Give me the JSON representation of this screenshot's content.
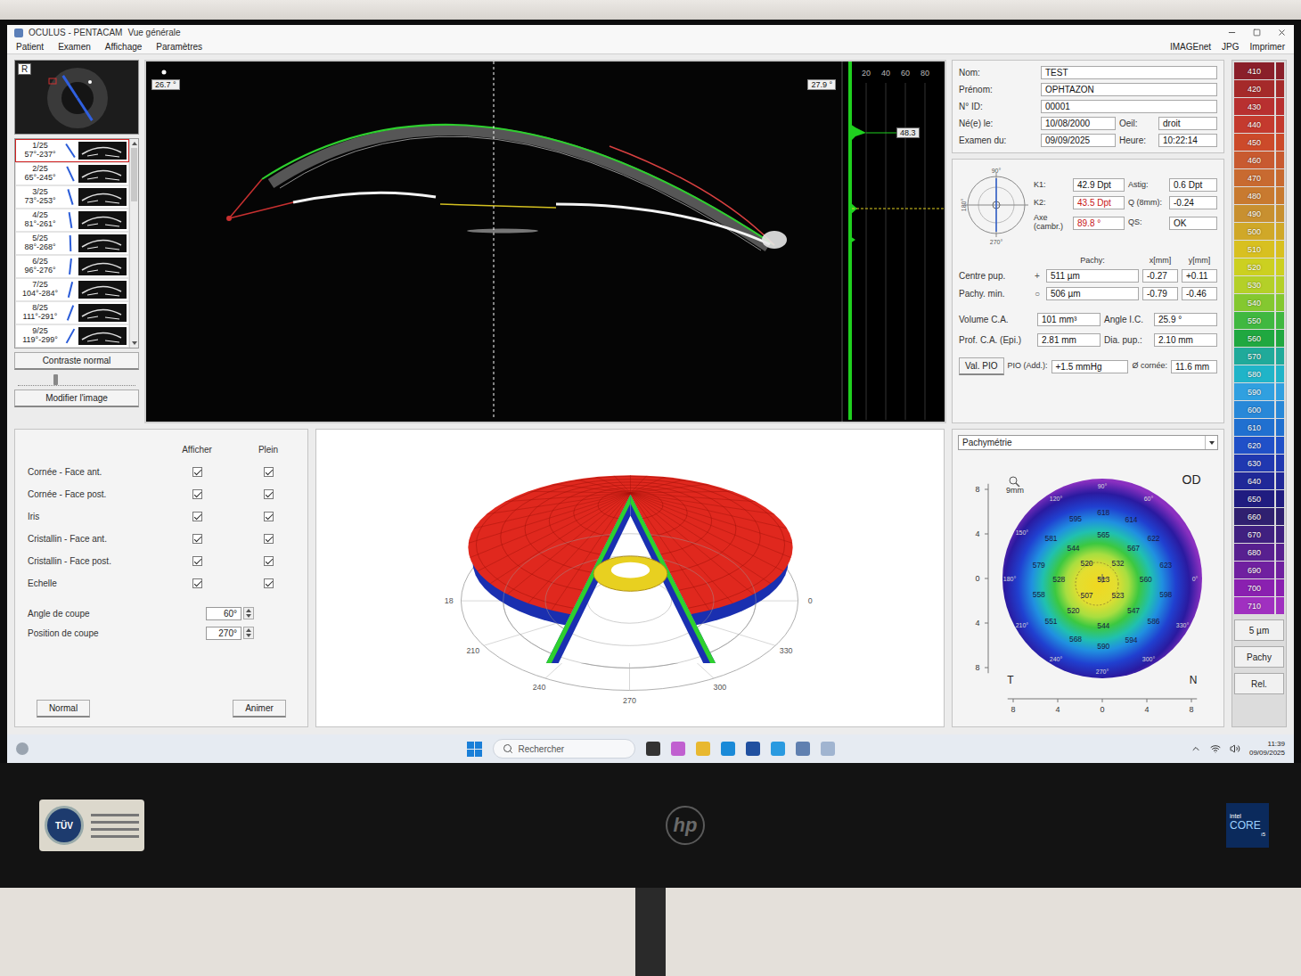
{
  "window": {
    "title": "OCULUS - PENTACAM",
    "view": "Vue générale"
  },
  "menu": [
    "Patient",
    "Examen",
    "Affichage",
    "Paramètres"
  ],
  "toolbar": [
    "IMAGEnet",
    "JPG",
    "Imprimer"
  ],
  "eye_thumb": {
    "label": "R"
  },
  "scans": [
    {
      "index": "1/25",
      "range": "57°-237°",
      "selected": true
    },
    {
      "index": "2/25",
      "range": "65°-245°",
      "selected": false
    },
    {
      "index": "3/25",
      "range": "73°-253°",
      "selected": false
    },
    {
      "index": "4/25",
      "range": "81°-261°",
      "selected": false
    },
    {
      "index": "5/25",
      "range": "88°-268°",
      "selected": false
    },
    {
      "index": "6/25",
      "range": "96°-276°",
      "selected": false
    },
    {
      "index": "7/25",
      "range": "104°-284°",
      "selected": false
    },
    {
      "index": "8/25",
      "range": "111°-291°",
      "selected": false
    },
    {
      "index": "9/25",
      "range": "119°-299°",
      "selected": false
    }
  ],
  "image_buttons": {
    "contrast": "Contraste normal",
    "modify": "Modifier l'image"
  },
  "contrast_slider": {
    "level": 0.3
  },
  "scheimpflug": {
    "left_angle": "26.7 °",
    "right_angle": "27.9 °"
  },
  "densitometry": {
    "ticks": [
      "20",
      "40",
      "60",
      "80"
    ],
    "peak": "48.3"
  },
  "patient": [
    {
      "label": "Nom:",
      "value": "TEST"
    },
    {
      "label": "Prénom:",
      "value": "OPHTAZON"
    },
    {
      "label": "N° ID:",
      "value": "00001"
    }
  ],
  "birth": {
    "label": "Né(e) le:",
    "value": "10/08/2000",
    "eye_label": "Oeil:",
    "eye": "droit"
  },
  "exam": {
    "label": "Examen du:",
    "value": "09/09/2025",
    "time_label": "Heure:",
    "time": "10:22:14"
  },
  "keratometry": {
    "axes": [
      "90°",
      "180°",
      "270°"
    ],
    "rows": [
      [
        {
          "label": "K1:",
          "value": "42.9 Dpt",
          "highlight": false
        },
        {
          "label": "Astig:",
          "value": "0.6 Dpt",
          "highlight": false
        }
      ],
      [
        {
          "label": "K2:",
          "value": "43.5 Dpt",
          "highlight": true
        },
        {
          "label": "Q (8mm):",
          "value": "-0.24",
          "highlight": false
        }
      ],
      [
        {
          "label": "Axe (cambr.)",
          "value": "89.8 °",
          "highlight": true
        },
        {
          "label": "QS:",
          "value": "OK",
          "highlight": false
        }
      ]
    ]
  },
  "pachy": {
    "headers": [
      "Pachy:",
      "x[mm]",
      "y[mm]"
    ],
    "rows": [
      {
        "label": "Centre pup.",
        "symbol": "+",
        "value": "511 µm",
        "x": "-0.27",
        "y": "+0.11"
      },
      {
        "label": "Pachy. min.",
        "symbol": "○",
        "value": "506 µm",
        "x": "-0.79",
        "y": "-0.46"
      }
    ]
  },
  "chamber": [
    [
      {
        "label": "Volume C.A.",
        "value": "101 mm³"
      },
      {
        "label": "Angle I.C.",
        "value": "25.9 °"
      }
    ],
    [
      {
        "label": "Prof. C.A. (Epi.)",
        "value": "2.81 mm"
      },
      {
        "label": "Dia. pup.:",
        "value": "2.10 mm"
      }
    ]
  ],
  "pio": {
    "button": "Val. PIO",
    "label": "PIO (Add.):",
    "value": "+1.5 mmHg",
    "cornea_label": "Ø cornée:",
    "cornea": "11.6 mm"
  },
  "scale": {
    "steps": [
      {
        "value": "410",
        "color": "#8a1f2a"
      },
      {
        "value": "420",
        "color": "#a52a2a"
      },
      {
        "value": "430",
        "color": "#b83030"
      },
      {
        "value": "440",
        "color": "#c43a2e"
      },
      {
        "value": "450",
        "color": "#cc4a2a"
      },
      {
        "value": "460",
        "color": "#c85a30"
      },
      {
        "value": "470",
        "color": "#c86a30"
      },
      {
        "value": "480",
        "color": "#c87a30"
      },
      {
        "value": "490",
        "color": "#c89030"
      },
      {
        "value": "500",
        "color": "#d0a828"
      },
      {
        "value": "510",
        "color": "#d8c020"
      },
      {
        "value": "520",
        "color": "#ccd020"
      },
      {
        "value": "530",
        "color": "#b4d028"
      },
      {
        "value": "540",
        "color": "#84c830"
      },
      {
        "value": "550",
        "color": "#40b840"
      },
      {
        "value": "560",
        "color": "#20a840"
      },
      {
        "value": "570",
        "color": "#20aa9a"
      },
      {
        "value": "580",
        "color": "#20b4c8"
      },
      {
        "value": "590",
        "color": "#30a0e0"
      },
      {
        "value": "600",
        "color": "#2888d8"
      },
      {
        "value": "610",
        "color": "#2070d0"
      },
      {
        "value": "620",
        "color": "#2050c8"
      },
      {
        "value": "630",
        "color": "#2038b0"
      },
      {
        "value": "640",
        "color": "#202898"
      },
      {
        "value": "650",
        "color": "#201c80"
      },
      {
        "value": "660",
        "color": "#302070"
      },
      {
        "value": "670",
        "color": "#402080"
      },
      {
        "value": "680",
        "color": "#582090"
      },
      {
        "value": "690",
        "color": "#7020a0"
      },
      {
        "value": "700",
        "color": "#8a20b0"
      },
      {
        "value": "710",
        "color": "#a030c0"
      }
    ],
    "unit": "5 µm",
    "buttons": [
      "Pachy",
      "Rel."
    ]
  },
  "display": {
    "headers": [
      "Afficher",
      "Plein"
    ],
    "rows": [
      {
        "label": "Cornée - Face ant.",
        "show": true,
        "fill": true
      },
      {
        "label": "Cornée - Face post.",
        "show": true,
        "fill": true
      },
      {
        "label": "Iris",
        "show": true,
        "fill": true
      },
      {
        "label": "Cristallin - Face ant.",
        "show": true,
        "fill": true
      },
      {
        "label": "Cristallin - Face post.",
        "show": true,
        "fill": true
      },
      {
        "label": "Echelle",
        "show": true,
        "fill": true
      }
    ]
  },
  "cut": {
    "angle_label": "Angle de coupe",
    "angle": "60°",
    "position_label": "Position de coupe",
    "position": "270°"
  },
  "view_buttons": [
    "Normal",
    "Animer"
  ],
  "view3d": {
    "labels": [
      {
        "label": "18",
        "deg": 180
      },
      {
        "label": "210",
        "deg": 210
      },
      {
        "label": "240",
        "deg": 240
      },
      {
        "label": "270",
        "deg": 270
      },
      {
        "label": "300",
        "deg": 300
      },
      {
        "label": "330",
        "deg": 330
      },
      {
        "label": "0",
        "deg": 0
      }
    ]
  },
  "map": {
    "type": "Pachymétrie",
    "zoom": "9mm",
    "eye": "OD",
    "temporal": "T",
    "nasal": "N",
    "y_ticks": [
      "8",
      "4",
      "0",
      "4",
      "8"
    ],
    "x_ticks": [
      "8",
      "4",
      "0",
      "4",
      "8"
    ],
    "angles": [
      {
        "label": "90°",
        "deg": 90
      },
      {
        "label": "120°",
        "deg": 120
      },
      {
        "label": "60°",
        "deg": 60
      },
      {
        "label": "150°",
        "deg": 150
      },
      {
        "label": "180°",
        "deg": 180
      },
      {
        "label": "0°",
        "deg": 0
      },
      {
        "label": "210°",
        "deg": 210
      },
      {
        "label": "330°",
        "deg": 330
      },
      {
        "label": "240°",
        "deg": 240
      },
      {
        "label": "300°",
        "deg": 300
      },
      {
        "label": "270°",
        "deg": 270
      }
    ],
    "points": [
      {
        "value": "618",
        "x": 0.1,
        "y": 5.9
      },
      {
        "value": "614",
        "x": 2.6,
        "y": 5.3
      },
      {
        "value": "595",
        "x": -2.4,
        "y": 5.4
      },
      {
        "value": "622",
        "x": 4.6,
        "y": 3.6
      },
      {
        "value": "581",
        "x": -4.6,
        "y": 3.6
      },
      {
        "value": "565",
        "x": 0.1,
        "y": 3.9
      },
      {
        "value": "567",
        "x": 2.8,
        "y": 2.7
      },
      {
        "value": "544",
        "x": -2.6,
        "y": 2.7
      },
      {
        "value": "579",
        "x": -5.7,
        "y": 1.2
      },
      {
        "value": "520",
        "x": -1.4,
        "y": 1.4
      },
      {
        "value": "532",
        "x": 1.4,
        "y": 1.4
      },
      {
        "value": "623",
        "x": 5.7,
        "y": 1.2
      },
      {
        "value": "528",
        "x": -3.9,
        "y": -0.1
      },
      {
        "value": "513",
        "x": 0.1,
        "y": -0.1
      },
      {
        "value": "560",
        "x": 3.9,
        "y": -0.1
      },
      {
        "value": "558",
        "x": -5.7,
        "y": -1.4
      },
      {
        "value": "507",
        "x": -1.4,
        "y": -1.5
      },
      {
        "value": "523",
        "x": 1.4,
        "y": -1.5
      },
      {
        "value": "598",
        "x": 5.7,
        "y": -1.4
      },
      {
        "value": "520",
        "x": -2.6,
        "y": -2.9
      },
      {
        "value": "547",
        "x": 2.8,
        "y": -2.9
      },
      {
        "value": "551",
        "x": -4.6,
        "y": -3.8
      },
      {
        "value": "586",
        "x": 4.6,
        "y": -3.8
      },
      {
        "value": "544",
        "x": 0.1,
        "y": -4.2
      },
      {
        "value": "568",
        "x": -2.4,
        "y": -5.4
      },
      {
        "value": "594",
        "x": 2.6,
        "y": -5.5
      },
      {
        "value": "590",
        "x": 0.1,
        "y": -6.1
      }
    ]
  },
  "taskbar": {
    "search": "Rechercher",
    "time": "11:39",
    "date": "09/09/2025"
  },
  "monitor": {
    "brand": "hp",
    "sticker": "TÜV",
    "cpu_brand": "intel",
    "cpu": "CORE",
    "cpu_model": "i5"
  }
}
